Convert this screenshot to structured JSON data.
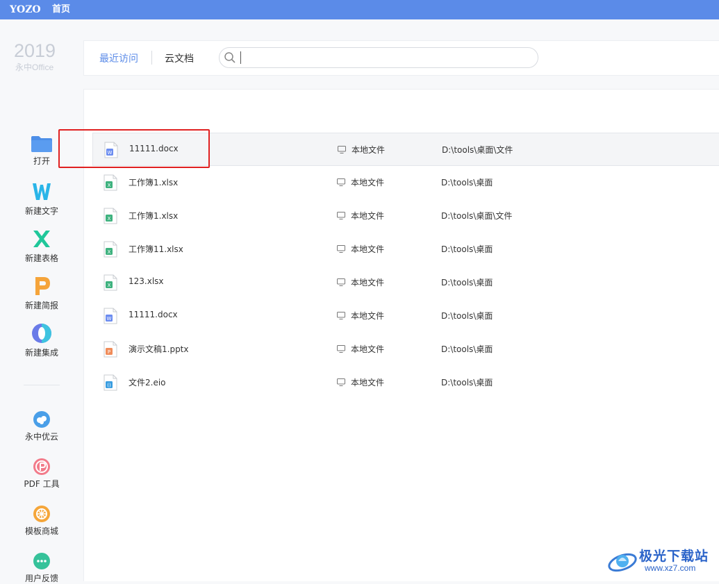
{
  "topbar": {
    "logo": "YOZO",
    "home_label": "首页"
  },
  "brand": {
    "year": "2019",
    "name": "永中Office"
  },
  "sidebar": {
    "items": [
      {
        "label": "打开",
        "icon": "folder-icon"
      },
      {
        "label": "新建文字",
        "icon": "writer-icon"
      },
      {
        "label": "新建表格",
        "icon": "spreadsheet-icon"
      },
      {
        "label": "新建简报",
        "icon": "presentation-icon"
      },
      {
        "label": "新建集成",
        "icon": "integration-icon"
      }
    ],
    "tools": [
      {
        "label": "永中优云",
        "icon": "cloud-icon"
      },
      {
        "label": "PDF 工具",
        "icon": "pdf-icon"
      },
      {
        "label": "模板商城",
        "icon": "template-icon"
      },
      {
        "label": "用户反馈",
        "icon": "feedback-icon"
      }
    ]
  },
  "header": {
    "tabs": [
      {
        "label": "最近访问",
        "active": true
      },
      {
        "label": "云文档",
        "active": false
      }
    ],
    "search": {
      "value": "",
      "placeholder": ""
    }
  },
  "files": [
    {
      "name": "11111.docx",
      "type": "word",
      "location": "本地文件",
      "path": "D:\\tools\\桌面\\文件",
      "selected": true
    },
    {
      "name": "工作簿1.xlsx",
      "type": "excel",
      "location": "本地文件",
      "path": "D:\\tools\\桌面",
      "selected": false
    },
    {
      "name": "工作簿1.xlsx",
      "type": "excel",
      "location": "本地文件",
      "path": "D:\\tools\\桌面\\文件",
      "selected": false
    },
    {
      "name": "工作簿11.xlsx",
      "type": "excel",
      "location": "本地文件",
      "path": "D:\\tools\\桌面",
      "selected": false
    },
    {
      "name": "123.xlsx",
      "type": "excel",
      "location": "本地文件",
      "path": "D:\\tools\\桌面",
      "selected": false
    },
    {
      "name": "11111.docx",
      "type": "word",
      "location": "本地文件",
      "path": "D:\\tools\\桌面",
      "selected": false
    },
    {
      "name": "演示文稿1.pptx",
      "type": "ppt",
      "location": "本地文件",
      "path": "D:\\tools\\桌面",
      "selected": false
    },
    {
      "name": "文件2.eio",
      "type": "eio",
      "location": "本地文件",
      "path": "D:\\tools\\桌面",
      "selected": false
    }
  ],
  "file_type_colors": {
    "word": "#6b8cf0",
    "excel": "#3fb27f",
    "ppt": "#f08c5a",
    "eio": "#3a9de0"
  },
  "file_type_letters": {
    "word": "W",
    "excel": "X",
    "ppt": "P",
    "eio": "()"
  },
  "accent_color": "#5b8be8",
  "highlight_color": "#e02020",
  "watermark": {
    "title": "极光下载站",
    "url": "www.xz7.com"
  }
}
